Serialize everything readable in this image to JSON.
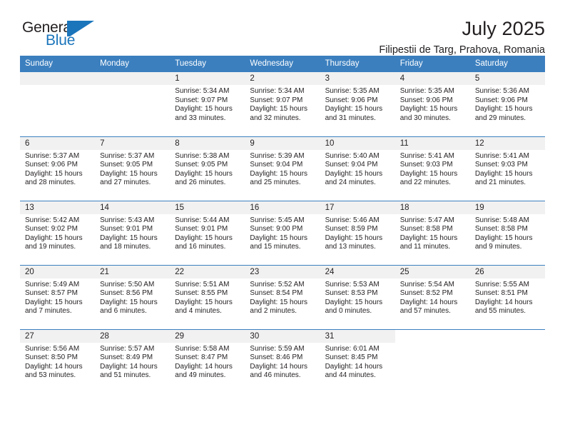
{
  "logo": {
    "word_one": "General",
    "word_two": "Blue",
    "flag_icon": "triangle-flag-icon"
  },
  "header": {
    "title": "July 2025",
    "subtitle": "Filipestii de Targ, Prahova, Romania"
  },
  "calendar": {
    "weekday_headers": [
      "Sunday",
      "Monday",
      "Tuesday",
      "Wednesday",
      "Thursday",
      "Friday",
      "Saturday"
    ],
    "accent_color": "#3b7fbf",
    "daynum_band_color": "#f1f1f1",
    "labels": {
      "sunrise": "Sunrise:",
      "sunset": "Sunset:",
      "daylight": "Daylight:"
    },
    "weeks": [
      [
        {
          "day": "",
          "empty": true
        },
        {
          "day": "",
          "empty": true
        },
        {
          "day": "1",
          "sunrise": "Sunrise: 5:34 AM",
          "sunset": "Sunset: 9:07 PM",
          "daylight_line1": "Daylight: 15 hours",
          "daylight_line2": "and 33 minutes."
        },
        {
          "day": "2",
          "sunrise": "Sunrise: 5:34 AM",
          "sunset": "Sunset: 9:07 PM",
          "daylight_line1": "Daylight: 15 hours",
          "daylight_line2": "and 32 minutes."
        },
        {
          "day": "3",
          "sunrise": "Sunrise: 5:35 AM",
          "sunset": "Sunset: 9:06 PM",
          "daylight_line1": "Daylight: 15 hours",
          "daylight_line2": "and 31 minutes."
        },
        {
          "day": "4",
          "sunrise": "Sunrise: 5:35 AM",
          "sunset": "Sunset: 9:06 PM",
          "daylight_line1": "Daylight: 15 hours",
          "daylight_line2": "and 30 minutes."
        },
        {
          "day": "5",
          "sunrise": "Sunrise: 5:36 AM",
          "sunset": "Sunset: 9:06 PM",
          "daylight_line1": "Daylight: 15 hours",
          "daylight_line2": "and 29 minutes."
        }
      ],
      [
        {
          "day": "6",
          "sunrise": "Sunrise: 5:37 AM",
          "sunset": "Sunset: 9:06 PM",
          "daylight_line1": "Daylight: 15 hours",
          "daylight_line2": "and 28 minutes."
        },
        {
          "day": "7",
          "sunrise": "Sunrise: 5:37 AM",
          "sunset": "Sunset: 9:05 PM",
          "daylight_line1": "Daylight: 15 hours",
          "daylight_line2": "and 27 minutes."
        },
        {
          "day": "8",
          "sunrise": "Sunrise: 5:38 AM",
          "sunset": "Sunset: 9:05 PM",
          "daylight_line1": "Daylight: 15 hours",
          "daylight_line2": "and 26 minutes."
        },
        {
          "day": "9",
          "sunrise": "Sunrise: 5:39 AM",
          "sunset": "Sunset: 9:04 PM",
          "daylight_line1": "Daylight: 15 hours",
          "daylight_line2": "and 25 minutes."
        },
        {
          "day": "10",
          "sunrise": "Sunrise: 5:40 AM",
          "sunset": "Sunset: 9:04 PM",
          "daylight_line1": "Daylight: 15 hours",
          "daylight_line2": "and 24 minutes."
        },
        {
          "day": "11",
          "sunrise": "Sunrise: 5:41 AM",
          "sunset": "Sunset: 9:03 PM",
          "daylight_line1": "Daylight: 15 hours",
          "daylight_line2": "and 22 minutes."
        },
        {
          "day": "12",
          "sunrise": "Sunrise: 5:41 AM",
          "sunset": "Sunset: 9:03 PM",
          "daylight_line1": "Daylight: 15 hours",
          "daylight_line2": "and 21 minutes."
        }
      ],
      [
        {
          "day": "13",
          "sunrise": "Sunrise: 5:42 AM",
          "sunset": "Sunset: 9:02 PM",
          "daylight_line1": "Daylight: 15 hours",
          "daylight_line2": "and 19 minutes."
        },
        {
          "day": "14",
          "sunrise": "Sunrise: 5:43 AM",
          "sunset": "Sunset: 9:01 PM",
          "daylight_line1": "Daylight: 15 hours",
          "daylight_line2": "and 18 minutes."
        },
        {
          "day": "15",
          "sunrise": "Sunrise: 5:44 AM",
          "sunset": "Sunset: 9:01 PM",
          "daylight_line1": "Daylight: 15 hours",
          "daylight_line2": "and 16 minutes."
        },
        {
          "day": "16",
          "sunrise": "Sunrise: 5:45 AM",
          "sunset": "Sunset: 9:00 PM",
          "daylight_line1": "Daylight: 15 hours",
          "daylight_line2": "and 15 minutes."
        },
        {
          "day": "17",
          "sunrise": "Sunrise: 5:46 AM",
          "sunset": "Sunset: 8:59 PM",
          "daylight_line1": "Daylight: 15 hours",
          "daylight_line2": "and 13 minutes."
        },
        {
          "day": "18",
          "sunrise": "Sunrise: 5:47 AM",
          "sunset": "Sunset: 8:58 PM",
          "daylight_line1": "Daylight: 15 hours",
          "daylight_line2": "and 11 minutes."
        },
        {
          "day": "19",
          "sunrise": "Sunrise: 5:48 AM",
          "sunset": "Sunset: 8:58 PM",
          "daylight_line1": "Daylight: 15 hours",
          "daylight_line2": "and 9 minutes."
        }
      ],
      [
        {
          "day": "20",
          "sunrise": "Sunrise: 5:49 AM",
          "sunset": "Sunset: 8:57 PM",
          "daylight_line1": "Daylight: 15 hours",
          "daylight_line2": "and 7 minutes."
        },
        {
          "day": "21",
          "sunrise": "Sunrise: 5:50 AM",
          "sunset": "Sunset: 8:56 PM",
          "daylight_line1": "Daylight: 15 hours",
          "daylight_line2": "and 6 minutes."
        },
        {
          "day": "22",
          "sunrise": "Sunrise: 5:51 AM",
          "sunset": "Sunset: 8:55 PM",
          "daylight_line1": "Daylight: 15 hours",
          "daylight_line2": "and 4 minutes."
        },
        {
          "day": "23",
          "sunrise": "Sunrise: 5:52 AM",
          "sunset": "Sunset: 8:54 PM",
          "daylight_line1": "Daylight: 15 hours",
          "daylight_line2": "and 2 minutes."
        },
        {
          "day": "24",
          "sunrise": "Sunrise: 5:53 AM",
          "sunset": "Sunset: 8:53 PM",
          "daylight_line1": "Daylight: 15 hours",
          "daylight_line2": "and 0 minutes."
        },
        {
          "day": "25",
          "sunrise": "Sunrise: 5:54 AM",
          "sunset": "Sunset: 8:52 PM",
          "daylight_line1": "Daylight: 14 hours",
          "daylight_line2": "and 57 minutes."
        },
        {
          "day": "26",
          "sunrise": "Sunrise: 5:55 AM",
          "sunset": "Sunset: 8:51 PM",
          "daylight_line1": "Daylight: 14 hours",
          "daylight_line2": "and 55 minutes."
        }
      ],
      [
        {
          "day": "27",
          "sunrise": "Sunrise: 5:56 AM",
          "sunset": "Sunset: 8:50 PM",
          "daylight_line1": "Daylight: 14 hours",
          "daylight_line2": "and 53 minutes."
        },
        {
          "day": "28",
          "sunrise": "Sunrise: 5:57 AM",
          "sunset": "Sunset: 8:49 PM",
          "daylight_line1": "Daylight: 14 hours",
          "daylight_line2": "and 51 minutes."
        },
        {
          "day": "29",
          "sunrise": "Sunrise: 5:58 AM",
          "sunset": "Sunset: 8:47 PM",
          "daylight_line1": "Daylight: 14 hours",
          "daylight_line2": "and 49 minutes."
        },
        {
          "day": "30",
          "sunrise": "Sunrise: 5:59 AM",
          "sunset": "Sunset: 8:46 PM",
          "daylight_line1": "Daylight: 14 hours",
          "daylight_line2": "and 46 minutes."
        },
        {
          "day": "31",
          "sunrise": "Sunrise: 6:01 AM",
          "sunset": "Sunset: 8:45 PM",
          "daylight_line1": "Daylight: 14 hours",
          "daylight_line2": "and 44 minutes."
        },
        {
          "day": "",
          "empty": true,
          "blank": true
        },
        {
          "day": "",
          "empty": true,
          "blank": true
        }
      ]
    ]
  }
}
